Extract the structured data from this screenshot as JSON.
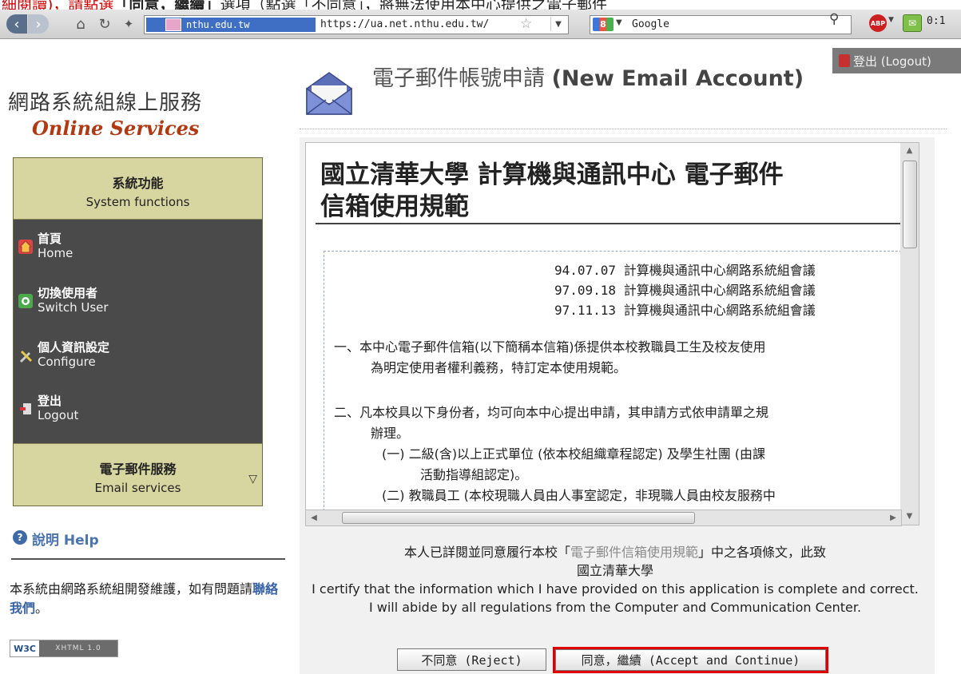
{
  "top_strip": {
    "part1": "細閱讀)，請點選",
    "part2": "「同意，繼續」",
    "part3": "選項（點選「不同意」，將無法使用本中心提供之電子郵件"
  },
  "browser": {
    "site_badge": "nthu.edu.tw",
    "url": "https://ua.net.nthu.edu.tw/",
    "search_engine": "Google",
    "abp_label": "ABP",
    "ext_count": "0:1"
  },
  "header": {
    "logout_top": "登出 (Logout)",
    "site_title_zh": "網路系統組線上服務",
    "site_title_en": "Online Services",
    "page_title_zh": "電子郵件帳號申請",
    "page_title_en": "(New Email Account)"
  },
  "sidebar": {
    "system_header_zh": "系統功能",
    "system_header_en": "System functions",
    "items": [
      {
        "zh": "首頁",
        "en": "Home",
        "icon": "home-icon"
      },
      {
        "zh": "切換使用者",
        "en": "Switch User",
        "icon": "switch-user-icon"
      },
      {
        "zh": "個人資訊設定",
        "en": "Configure",
        "icon": "configure-icon"
      },
      {
        "zh": "登出",
        "en": "Logout",
        "icon": "logout-icon"
      }
    ],
    "email_header_zh": "電子郵件服務",
    "email_header_en": "Email services"
  },
  "help": {
    "label": "說明 Help",
    "text_before": "本系統由網路系統組開發維護，如有問題請",
    "link": "聯絡我們",
    "text_after": "。",
    "badge_a": "W3C",
    "badge_b": "XHTML 1.0"
  },
  "terms": {
    "heading_line1": "國立清華大學 計算機與通訊中心 電子郵件",
    "heading_line2": "信箱使用規範",
    "dates": [
      "94.07.07 計算機與通訊中心網路系統組會議",
      "97.09.18 計算機與通訊中心網路系統組會議",
      "97.11.13 計算機與通訊中心網路系統組會議"
    ],
    "clause1_a": "一、本中心電子郵件信箱(以下簡稱本信箱)係提供本校教職員工生及校友使用",
    "clause1_b": "為明定使用者權利義務，特訂定本使用規範。",
    "clause2_a": "二、凡本校具以下身份者，均可向本中心提出申請，其申請方式依申請單之規",
    "clause2_b": "辦理。",
    "clause2_c": "(一) 二級(含)以上正式單位 (依本校組織章程認定) 及學生社團 (由課",
    "clause2_d": "活動指導組認定)。",
    "clause2_e": "(二) 教職員工 (本校現職人員由人事室認定，非現職人員由校友服務中"
  },
  "certification": {
    "zh_before": "本人已詳閱並同意履行本校「",
    "zh_link": "電子郵件信箱使用規範",
    "zh_after": "」中之各項條文，此致",
    "zh_line2": "國立清華大學",
    "en_text": "I certify that the information which I have provided on this application is complete and correct. I will abide by all regulations from the Computer and Communication Center."
  },
  "buttons": {
    "reject": "不同意 (Reject)",
    "accept": "同意，繼續 (Accept and Continue)"
  },
  "colors": {
    "highlight": "#e00000",
    "site_title_en": "#b23a12",
    "sidebar_bg": "#4a4a4a",
    "sidebar_header_bg": "#d8d6a0"
  }
}
